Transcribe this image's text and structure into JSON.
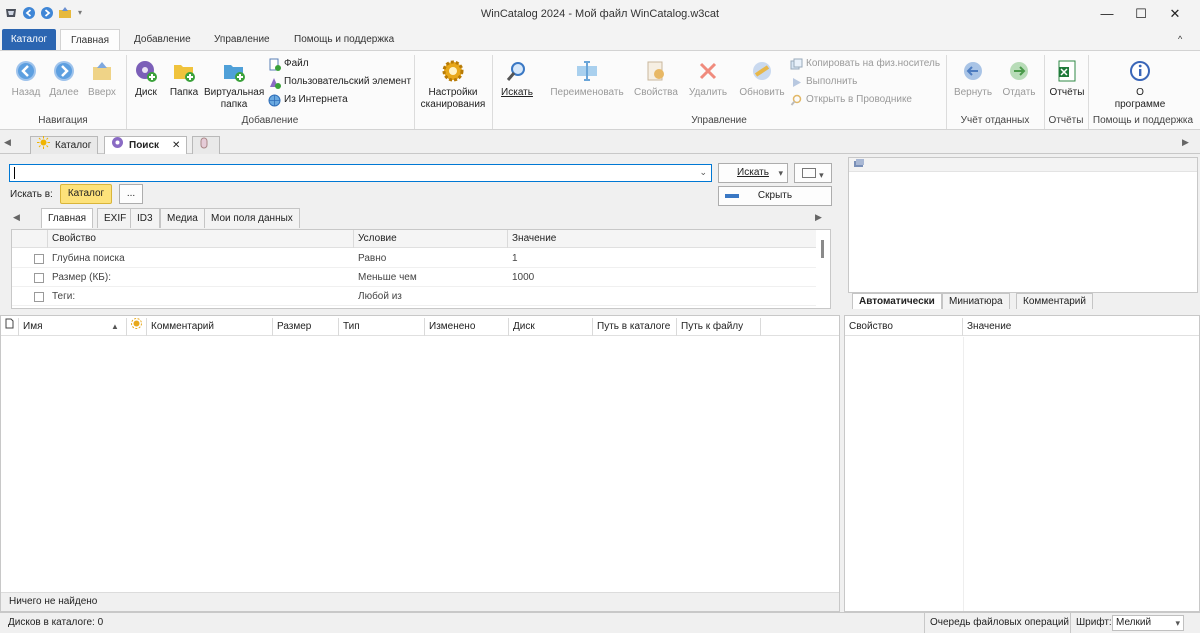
{
  "window": {
    "title": "WinCatalog 2024 - Мой файл WinCatalog.w3cat",
    "minimize": "—",
    "maximize": "☐",
    "close": "✕"
  },
  "ribbon_tabs": [
    "Каталог",
    "Главная",
    "Добавление",
    "Управление",
    "Помощь и поддержка"
  ],
  "ribbon": {
    "nav": {
      "back": "Назад",
      "forward": "Далее",
      "up": "Вверх",
      "group": "Навигация"
    },
    "add": {
      "disk": "Диск",
      "folder": "Папка",
      "virtual_folder_1": "Виртуальная",
      "virtual_folder_2": "папка",
      "file": "Файл",
      "custom_item": "Пользовательский элемент",
      "from_internet": "Из Интернета",
      "group": "Добавление"
    },
    "scan": {
      "label_1": "Настройки",
      "label_2": "сканирования"
    },
    "manage": {
      "search": "Искать",
      "rename": "Переименовать",
      "properties": "Свойства",
      "delete": "Удалить",
      "refresh": "Обновить",
      "copy_to_media": "Копировать на физ.носитель",
      "execute": "Выполнить",
      "open_explorer": "Открыть в Проводнике",
      "group": "Управление"
    },
    "loans": {
      "return": "Вернуть",
      "lend": "Отдать",
      "group": "Учёт отданных"
    },
    "reports": {
      "label": "Отчёты",
      "group": "Отчёты"
    },
    "help": {
      "about_1": "О",
      "about_2": "программе",
      "group": "Помощь и поддержка"
    },
    "collapse": "^"
  },
  "doc_tabs": {
    "catalog": "Каталог",
    "search": "Поиск",
    "close": "✕"
  },
  "search": {
    "query": "",
    "search_button": "Искать",
    "hide_button": "Скрыть",
    "search_in_label": "Искать в:",
    "search_in_value": "Каталог",
    "browse": "...",
    "subtabs": [
      "Главная",
      "EXIF",
      "ID3",
      "Медиа",
      "Мои поля данных"
    ],
    "columns": [
      "Свойство",
      "Условие",
      "Значение"
    ],
    "rows": [
      {
        "property": "Глубина поиска",
        "condition": "Равно",
        "value": "1"
      },
      {
        "property": "Размер (КБ):",
        "condition": "Меньше чем",
        "value": "1000"
      },
      {
        "property": "Теги:",
        "condition": "Любой из",
        "value": ""
      }
    ]
  },
  "preview": {
    "tabs": [
      "Автоматически",
      "Миниатюра",
      "Комментарий"
    ]
  },
  "file_list": {
    "columns": [
      "Имя",
      "Комментарий",
      "Размер",
      "Тип",
      "Изменено",
      "Диск",
      "Путь в каталоге",
      "Путь к файлу"
    ],
    "status": "Ничего не найдено"
  },
  "properties_panel": {
    "columns": [
      "Свойство",
      "Значение"
    ]
  },
  "statusbar": {
    "disks": "Дисков в каталоге: 0",
    "queue": "Очередь файловых операций",
    "font_label": "Шрифт:",
    "font_value": "Мелкий"
  },
  "colors": {
    "accent": "#2b65b1",
    "ribbon_bg": "#fbfbfb",
    "disabled": "#9a9a9a"
  }
}
